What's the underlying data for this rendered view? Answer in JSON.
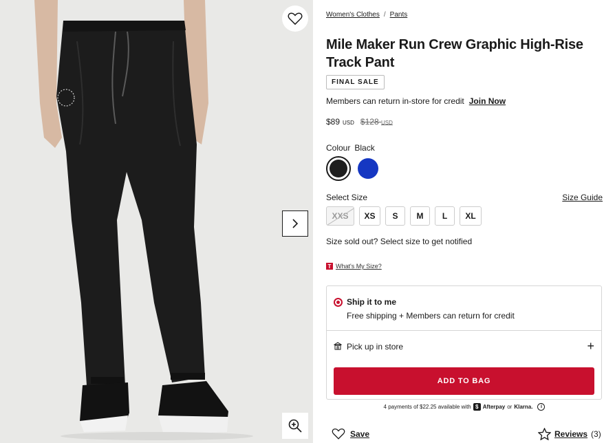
{
  "media": {
    "icons": {
      "wishlist": "heart-icon",
      "next": "chevron-right-icon",
      "zoom": "zoom-in-icon"
    }
  },
  "breadcrumb": {
    "items": [
      "Women's Clothes",
      "Pants"
    ],
    "separator": "/"
  },
  "product": {
    "title": "Mile Maker Run Crew Graphic High-Rise Track Pant",
    "badge": "FINAL SALE",
    "members_text": "Members can return in-store for credit",
    "join_label": "Join Now",
    "price": {
      "current": "$89",
      "currency": "USD",
      "original": "$128",
      "original_currency": "USD"
    }
  },
  "colour": {
    "label": "Colour",
    "selected": "Black",
    "swatches": [
      {
        "name": "Black",
        "color": "#1e1e1e",
        "selected": true
      },
      {
        "name": "Blue",
        "color": "#1537c2",
        "selected": false
      }
    ]
  },
  "size": {
    "label": "Select Size",
    "guide_label": "Size Guide",
    "options": [
      {
        "label": "XXS",
        "available": false
      },
      {
        "label": "XS",
        "available": true
      },
      {
        "label": "S",
        "available": true
      },
      {
        "label": "M",
        "available": true
      },
      {
        "label": "L",
        "available": true
      },
      {
        "label": "XL",
        "available": true
      }
    ],
    "soldout_text": "Size sold out? Select size to get notified",
    "whats_my_size_badge": "T",
    "whats_my_size": "What's My Size?"
  },
  "fulfilment": {
    "ship_title": "Ship it to me",
    "ship_sub": "Free shipping + Members can return for credit",
    "pickup_label": "Pick up in store",
    "add_to_bag": "ADD TO BAG"
  },
  "payments": {
    "text": "4 payments of $22.25 available with",
    "afterpay_badge": "$",
    "afterpay": "Afterpay",
    "or": "or",
    "klarna": "Klarna.",
    "info": "i"
  },
  "footer": {
    "save_label": "Save",
    "reviews_label": "Reviews",
    "reviews_count": "(3)"
  },
  "colors": {
    "accent": "#c8102e",
    "text": "#1a1a1a",
    "border": "#d5d5d5"
  }
}
